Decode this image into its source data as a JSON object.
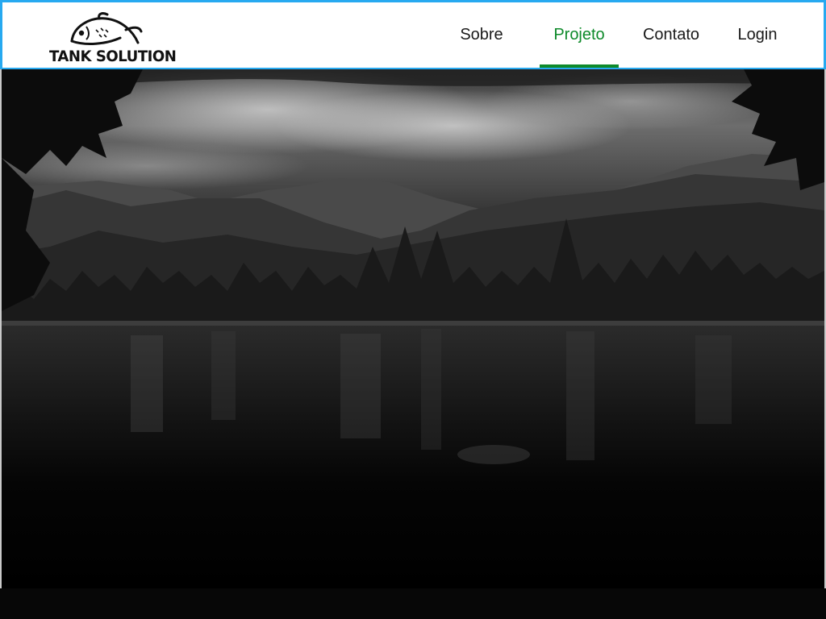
{
  "brand": {
    "name": "TANK SOLUTION",
    "logo_icon": "fish-icon"
  },
  "nav": {
    "items": [
      {
        "label": "Sobre",
        "active": false
      },
      {
        "label": "Projeto",
        "active": true
      },
      {
        "label": "Contato",
        "active": false
      },
      {
        "label": "Login",
        "active": false
      }
    ]
  },
  "hero": {
    "image": "black-and-white landscape of lake, forested mountains and cloudy sky"
  },
  "colors": {
    "accent": "#0e8a2a",
    "navbar_border": "#27a9f0",
    "text": "#1a1a1a"
  }
}
